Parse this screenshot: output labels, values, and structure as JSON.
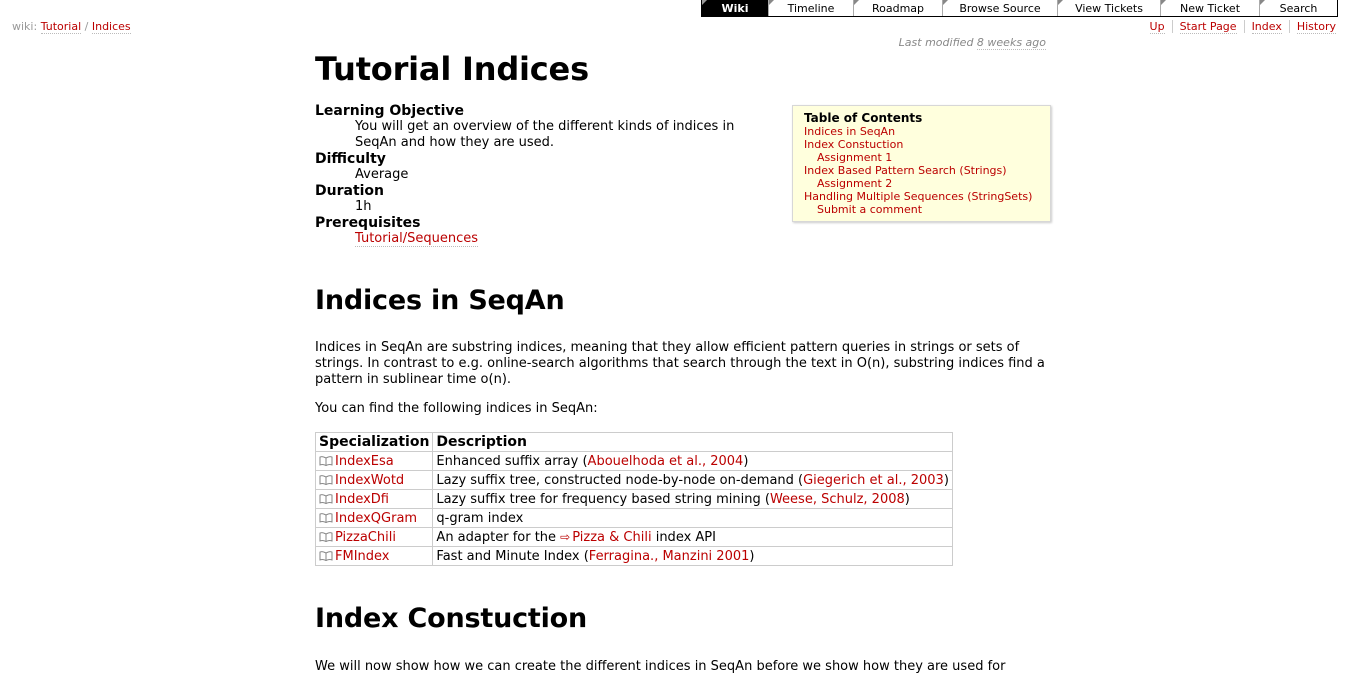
{
  "mainnav": [
    {
      "label": "Wiki",
      "active": true
    },
    {
      "label": "Timeline"
    },
    {
      "label": "Roadmap"
    },
    {
      "label": "Browse Source"
    },
    {
      "label": "View Tickets"
    },
    {
      "label": "New Ticket"
    },
    {
      "label": "Search"
    }
  ],
  "breadcrumb": {
    "prefix": "wiki:",
    "part1": "Tutorial",
    "sep": "/",
    "part2": "Indices"
  },
  "ctxnav": [
    "Up",
    "Start Page",
    "Index",
    "History"
  ],
  "lastmod": {
    "prefix": "Last modified",
    "age": "8 weeks ago"
  },
  "page": {
    "title": "Tutorial Indices",
    "meta": [
      {
        "term": "Learning Objective",
        "desc": "You will get an overview of the different kinds of indices in SeqAn and how they are used."
      },
      {
        "term": "Difficulty",
        "desc": "Average"
      },
      {
        "term": "Duration",
        "desc": "1h"
      },
      {
        "term": "Prerequisites",
        "link": "Tutorial/Sequences"
      }
    ],
    "section1_title": "Indices in SeqAn",
    "section1_p1": "Indices in SeqAn are substring indices, meaning that they allow efficient pattern queries in strings or sets of strings. In contrast to e.g. online-search algorithms that search through the text in O(n), substring indices find a pattern in sublinear time o(n).",
    "section1_p2": "You can find the following indices in SeqAn:",
    "table": {
      "headers": [
        "Specialization",
        "Description"
      ],
      "rows": [
        {
          "spec": "IndexEsa",
          "desc_pre": "Enhanced suffix array (",
          "ref": "Abouelhoda et al., 2004",
          "desc_post": ")"
        },
        {
          "spec": "IndexWotd",
          "desc_pre": "Lazy suffix tree, constructed node-by-node on-demand (",
          "ref": "Giegerich et al., 2003",
          "desc_post": ")"
        },
        {
          "spec": "IndexDfi",
          "desc_pre": "Lazy suffix tree for frequency based string mining (",
          "ref": "Weese, Schulz, 2008",
          "desc_post": ")"
        },
        {
          "spec": "IndexQGram",
          "desc_pre": "q-gram index",
          "ref": "",
          "desc_post": ""
        },
        {
          "spec": "PizzaChili",
          "desc_pre": "An adapter for the ",
          "ext": "Pizza & Chili",
          "desc_post": " index API"
        },
        {
          "spec": "FMIndex",
          "desc_pre": "Fast and Minute Index (",
          "ref": "Ferragina., Manzini 2001",
          "desc_post": ")"
        }
      ]
    },
    "section2_title": "Index Constuction",
    "section2_p1": "We will now show how we can create the different indices in SeqAn before we show how they are used for"
  },
  "toc": {
    "title": "Table of Contents",
    "items": [
      {
        "label": "Indices in SeqAn",
        "level": 1
      },
      {
        "label": "Index Constuction",
        "level": 1
      },
      {
        "label": "Assignment 1",
        "level": 2
      },
      {
        "label": "Index Based Pattern Search (Strings)",
        "level": 1
      },
      {
        "label": "Assignment 2",
        "level": 2
      },
      {
        "label": "Handling Multiple Sequences (StringSets)",
        "level": 1
      },
      {
        "label": "Submit a comment",
        "level": 2
      }
    ]
  },
  "colors": {
    "link": "#bb0000",
    "toc_bg": "#ffffdd"
  }
}
